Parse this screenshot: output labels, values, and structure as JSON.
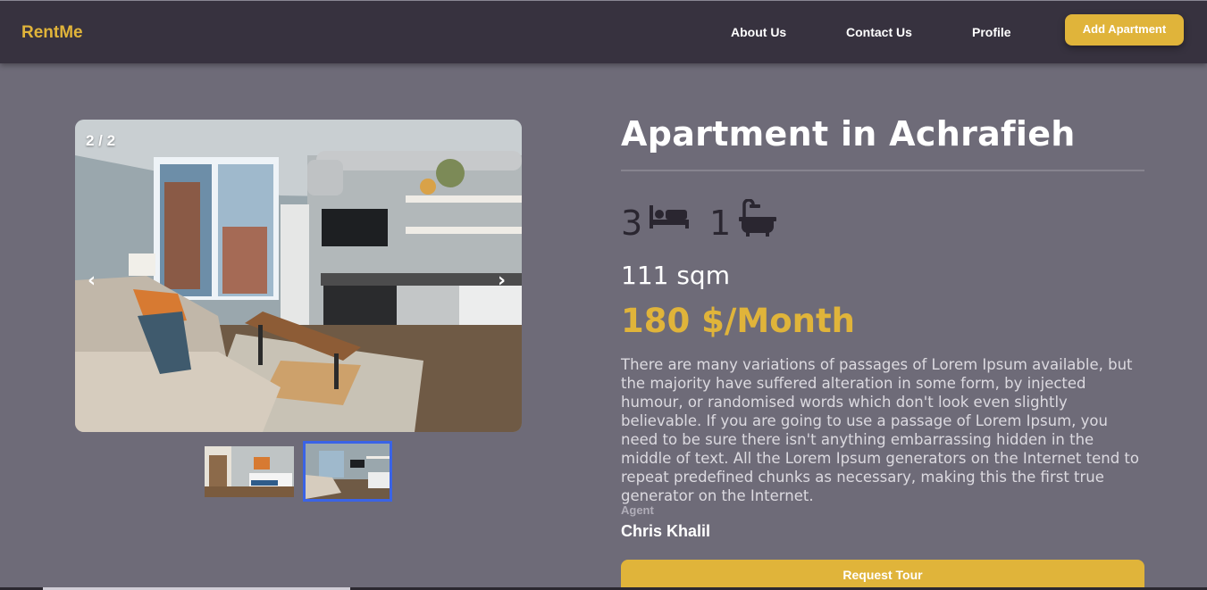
{
  "nav": {
    "brand": "RentMe",
    "links": [
      "About Us",
      "Contact Us",
      "Profile"
    ],
    "add_button": "Add Apartment"
  },
  "gallery": {
    "counter": "2 / 2",
    "prev": "‹",
    "next": "›",
    "current_index": 2,
    "total": 2
  },
  "listing": {
    "title": "Apartment in Achrafieh",
    "bedrooms": "3",
    "bathrooms": "1",
    "area": "111 sqm",
    "price": "180 $/Month",
    "description": "There are many variations of passages of Lorem Ipsum available, but the majority have suffered alteration in some form, by injected humour, or randomised words which don't look even slightly believable. If you are going to use a passage of Lorem Ipsum, you need to be sure there isn't anything embarrassing hidden in the middle of text. All the Lorem Ipsum generators on the Internet tend to repeat predefined chunks as necessary, making this the first true generator on the Internet.",
    "agent_label": "Agent",
    "agent_name": "Chris Khalil",
    "tour_button": "Request Tour"
  },
  "icons": {
    "bed": "bed-icon",
    "bath": "bath-icon",
    "prev": "chevron-left-icon",
    "next": "chevron-right-icon"
  },
  "colors": {
    "accent": "#e0b43a",
    "navbar": "#37323f",
    "background": "#6e6b78",
    "thumb_active_border": "#3a63e6"
  }
}
